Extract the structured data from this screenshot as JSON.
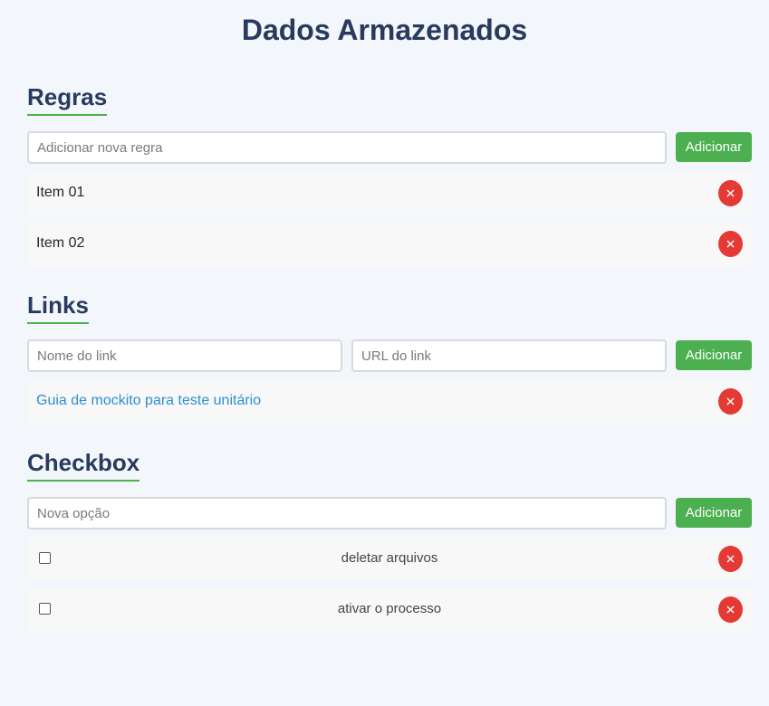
{
  "page": {
    "title": "Dados Armazenados"
  },
  "rules": {
    "heading": "Regras",
    "input_placeholder": "Adicionar nova regra",
    "add_label": "Adicionar",
    "items": [
      {
        "text": "Item 01"
      },
      {
        "text": "Item 02"
      }
    ]
  },
  "links": {
    "heading": "Links",
    "name_placeholder": "Nome do link",
    "url_placeholder": "URL do link",
    "add_label": "Adicionar",
    "items": [
      {
        "text": "Guia de mockito para teste unitário"
      }
    ]
  },
  "checkbox": {
    "heading": "Checkbox",
    "input_placeholder": "Nova opção",
    "add_label": "Adicionar",
    "items": [
      {
        "label": "deletar arquivos",
        "checked": false
      },
      {
        "label": "ativar o processo",
        "checked": false
      }
    ]
  },
  "icons": {
    "delete": "close-icon"
  },
  "colors": {
    "accent_green": "#4caf50",
    "delete_red": "#e53935",
    "heading_navy": "#283a5e",
    "link_blue": "#2d8fd5"
  }
}
